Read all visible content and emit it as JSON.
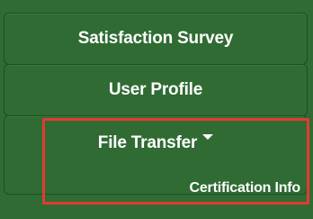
{
  "menu": {
    "items": [
      {
        "label": "Satisfaction Survey"
      },
      {
        "label": "User Profile"
      },
      {
        "label": "File Transfer"
      }
    ],
    "dropdown": {
      "items": [
        {
          "label": "Certification Info"
        }
      ]
    }
  },
  "colors": {
    "background": "#2f6b33",
    "border": "#1f4d22",
    "text": "#ffffff",
    "highlight": "#e53935"
  }
}
